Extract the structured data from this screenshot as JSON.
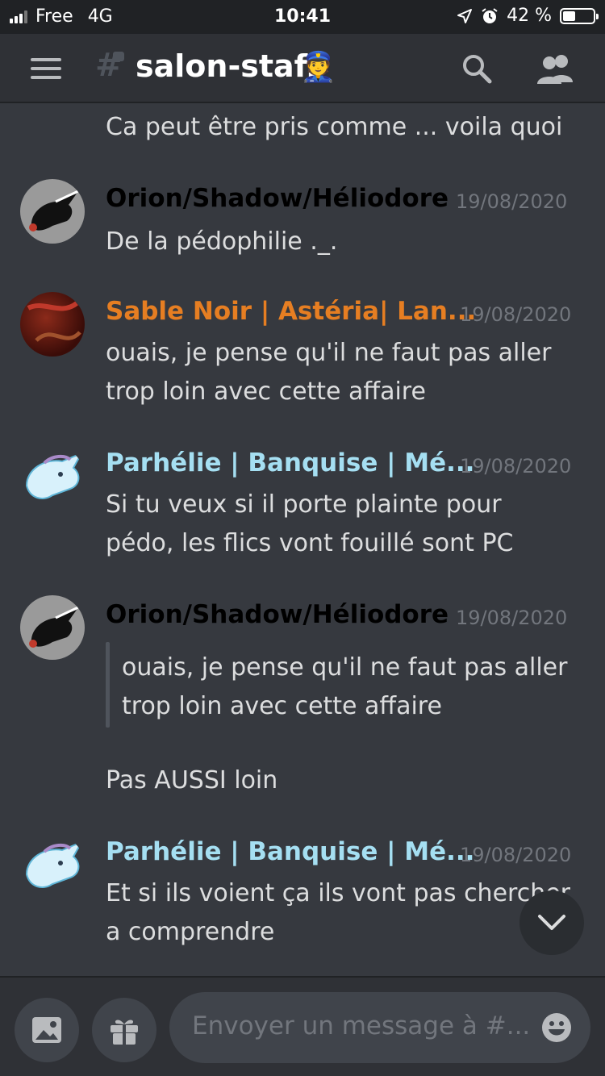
{
  "status_bar": {
    "carrier": "Free",
    "network": "4G",
    "time": "10:41",
    "battery": "42 %",
    "battery_level": 0.42
  },
  "header": {
    "channel_name": "salon-staff",
    "channel_emoji": "👮",
    "icons": [
      "hamburger-icon",
      "locked-channel-hash-icon",
      "search-icon",
      "members-icon"
    ]
  },
  "messages": {
    "m0": {
      "text": "Ca peut être pris comme ... voila quoi"
    },
    "m1": {
      "author": "Orion/Shadow/Héliodore",
      "timestamp": "19/08/2020",
      "color": "#000000",
      "lines": [
        "De la pédophilie ._."
      ]
    },
    "m2": {
      "author": "Sable Noir | Astéria| Lan...",
      "timestamp": "19/08/2020",
      "color": "#e67e22",
      "lines": [
        "ouais, je pense qu'il ne faut pas aller",
        "trop loin avec cette affaire"
      ]
    },
    "m3": {
      "author": "Parhélie | Banquise | Mé...",
      "timestamp": "19/08/2020",
      "color": "#a5dff2",
      "lines": [
        "Si tu veux si il porte plainte pour",
        "pédo, les flics vont fouillé sont PC"
      ]
    },
    "m4": {
      "author": "Orion/Shadow/Héliodore",
      "timestamp": "19/08/2020",
      "color": "#000000",
      "quote": [
        "ouais, je pense qu'il ne faut pas aller",
        "trop loin avec cette affaire"
      ],
      "lines": [
        "Pas AUSSI loin"
      ]
    },
    "m5": {
      "author": "Parhélie | Banquise | Mé...",
      "timestamp": "19/08/2020",
      "color": "#a5dff2",
      "lines": [
        "Et si ils voient ça ils vont pas chercher",
        "a comprendre"
      ]
    }
  },
  "composer": {
    "placeholder": "Envoyer un message à #...",
    "icons": [
      "image-icon",
      "gift-icon",
      "emoji-icon"
    ]
  },
  "scroll_button": {
    "icon": "chevron-down-icon"
  }
}
